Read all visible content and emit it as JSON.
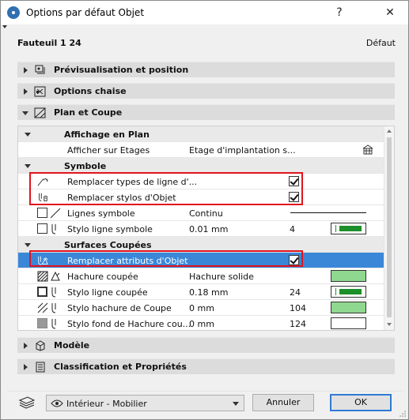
{
  "window": {
    "title": "Options par défaut Objet",
    "help_label": "?",
    "close_label": "✕"
  },
  "header": {
    "object_name": "Fauteuil 1 24",
    "default_label": "Défaut"
  },
  "sections": [
    {
      "label": "Prévisualisation et position",
      "icon": "preview-icon",
      "expanded": false
    },
    {
      "label": "Options chaise",
      "icon": "chair-options-icon",
      "expanded": false
    },
    {
      "label": "Plan et Coupe",
      "icon": "plan-section-icon",
      "expanded": true
    },
    {
      "label": "Modèle",
      "icon": "model-cube-icon",
      "expanded": false
    },
    {
      "label": "Classification et Propriétés",
      "icon": "classification-icon",
      "expanded": false
    }
  ],
  "plan": {
    "affichage": {
      "group_label": "Affichage en Plan",
      "afficher_label": "Afficher sur Etages",
      "afficher_value": "Etage d'implantation s..."
    },
    "symbole": {
      "group_label": "Symbole",
      "remplacer_types_label": "Remplacer types de ligne d'...",
      "remplacer_types_checked": true,
      "remplacer_stylos_label": "Remplacer stylos d'Objet",
      "remplacer_stylos_checked": true,
      "lignes_label": "Lignes symbole",
      "lignes_value": "Continu",
      "stylo_label": "Stylo ligne symbole",
      "stylo_value": "0.01 mm",
      "stylo_num": "4"
    },
    "surfaces": {
      "group_label": "Surfaces Coupées",
      "remplacer_attr_label": "Remplacer attributs d'Objet",
      "remplacer_attr_checked": true,
      "hachure_label": "Hachure coupée",
      "hachure_value": "Hachure solide",
      "stylo_ligne_label": "Stylo ligne coupée",
      "stylo_ligne_value": "0.18 mm",
      "stylo_ligne_num": "24",
      "stylo_hachure_label": "Stylo hachure de Coupe",
      "stylo_hachure_value": "0 mm",
      "stylo_hachure_num": "104",
      "stylo_fond_label": "Stylo fond de Hachure cou...",
      "stylo_fond_value": "0 mm",
      "stylo_fond_num": "124"
    }
  },
  "footer": {
    "view_label": "Intérieur - Mobilier",
    "cancel_label": "Annuler",
    "ok_label": "OK"
  },
  "colors": {
    "selection": "#3a87d8",
    "highlight": "#e0141e",
    "pen_green": "#1b8f2a",
    "swatch_light_green": "#8fd88f"
  }
}
